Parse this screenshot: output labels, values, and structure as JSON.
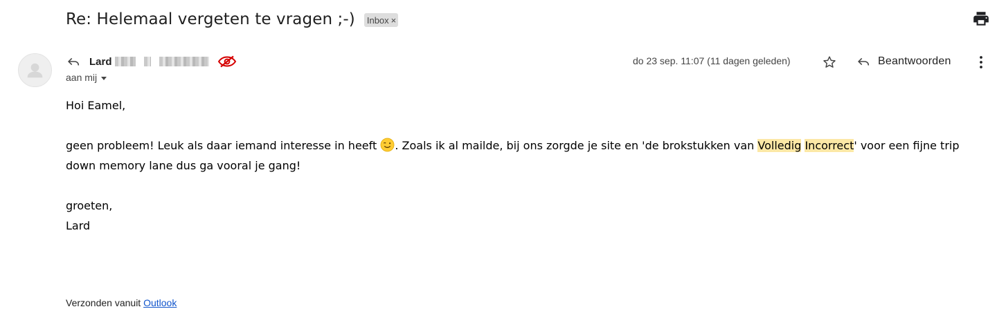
{
  "subject": "Re: Helemaal vergeten te vragen ;-)",
  "label_chip": {
    "text": "Inbox",
    "remove": "×"
  },
  "sender": {
    "name": "Lard"
  },
  "recipient": "aan mij",
  "date": "do 23 sep. 11:07 (11 dagen geleden)",
  "reply_label": "Beantwoorden",
  "body": {
    "greeting": "Hoi Eamel,",
    "line_part1": "geen probleem! Leuk als daar iemand interesse in heeft ",
    "line_part2": ". Zoals ik al mailde, bij ons zorgde je site en 'de brokstukken van ",
    "hl_word1": "Volledig",
    "hl_word2": "Incorrect",
    "line_part3": "' voor een fijne trip down memory lane dus ga vooral je gang!",
    "closing": "groeten,",
    "signature": "Lard"
  },
  "footer": {
    "prefix": "Verzonden vanuit ",
    "link": "Outlook"
  },
  "icons": {
    "print": "print-icon",
    "reply": "reply-icon",
    "star": "star-icon",
    "more": "more-vert-icon",
    "eye": "eye-off-icon",
    "avatar": "person-icon",
    "smiley": "winking-face-icon"
  },
  "colors": {
    "highlight": "#fce8a6",
    "eye_icon": "#d50000",
    "link": "#1155cc"
  }
}
